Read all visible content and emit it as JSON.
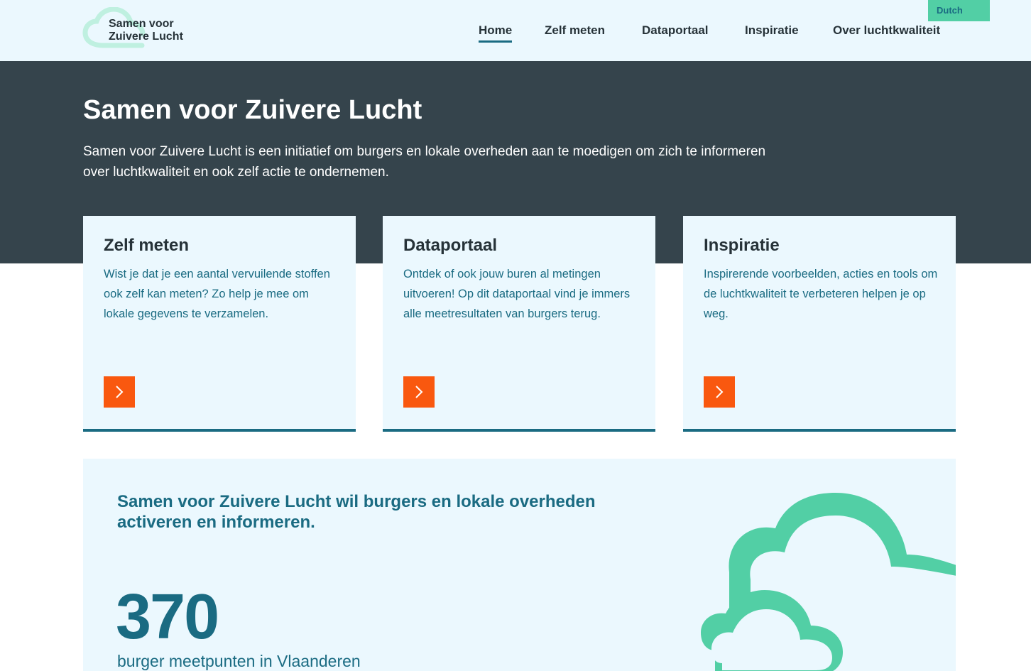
{
  "header": {
    "logo_line1": "Samen voor",
    "logo_line2": "Zuivere Lucht",
    "nav": [
      {
        "label": "Home",
        "active": true
      },
      {
        "label": "Zelf meten",
        "active": false
      },
      {
        "label": "Dataportaal",
        "active": false
      },
      {
        "label": "Inspiratie",
        "active": false
      },
      {
        "label": "Over luchtkwaliteit",
        "active": false
      }
    ],
    "language": "Dutch"
  },
  "hero": {
    "title": "Samen voor Zuivere Lucht",
    "text": "Samen voor Zuivere Lucht is een initiatief om burgers en lokale overheden aan te moedigen om zich te informeren over luchtkwaliteit en ook zelf actie te ondernemen."
  },
  "cards": [
    {
      "title": "Zelf meten",
      "text": "Wist je dat je een aantal vervuilende stoffen ook zelf kan meten? Zo help je mee om lokale gegevens te verzamelen."
    },
    {
      "title": "Dataportaal",
      "text": "Ontdek of ook jouw buren al metingen uitvoeren! Op dit dataportaal vind je immers alle meetresultaten van burgers terug."
    },
    {
      "title": "Inspiratie",
      "text": "Inspirerende voorbeelden, acties en tools om de luchtkwaliteit te verbeteren helpen je op weg."
    }
  ],
  "stats": {
    "heading": "Samen voor Zuivere Lucht wil burgers en lokale overheden activeren en informeren.",
    "number": "370",
    "label": "burger meetpunten in Vlaanderen"
  },
  "colors": {
    "header_bg": "#ebf8fe",
    "hero_bg": "#35444c",
    "accent_teal": "#1a6b82",
    "accent_green": "#52cfa5",
    "button_orange": "#f9580f"
  },
  "icons": {
    "logo": "cloud-logo-icon",
    "card_button": "chevron-right-icon",
    "illustration": "cloud-illustration"
  }
}
